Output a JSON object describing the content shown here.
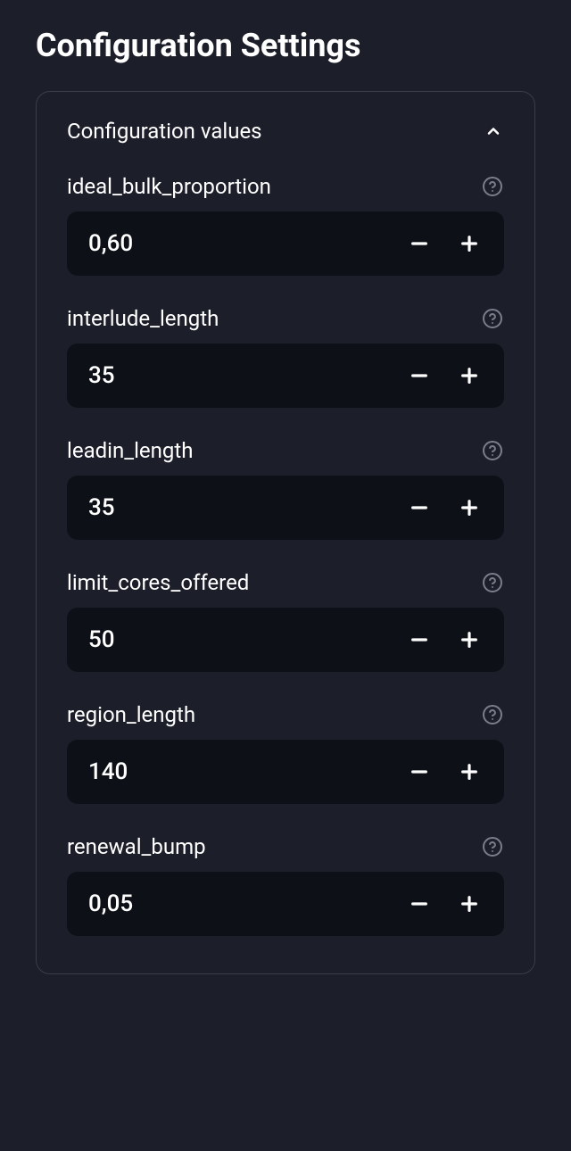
{
  "page_title": "Configuration Settings",
  "panel": {
    "title": "Configuration values",
    "fields": [
      {
        "label": "ideal_bulk_proportion",
        "value": "0,60"
      },
      {
        "label": "interlude_length",
        "value": "35"
      },
      {
        "label": "leadin_length",
        "value": "35"
      },
      {
        "label": "limit_cores_offered",
        "value": "50"
      },
      {
        "label": "region_length",
        "value": "140"
      },
      {
        "label": "renewal_bump",
        "value": "0,05"
      }
    ]
  }
}
